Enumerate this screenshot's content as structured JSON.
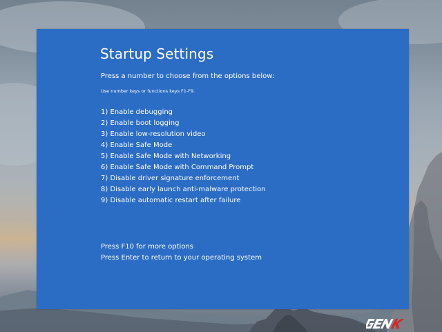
{
  "startup_settings": {
    "title": "Startup Settings",
    "prompt": "Press a number to choose from the options below:",
    "hint": "Use number keys or functions keys F1-F9.",
    "options": [
      {
        "label": "1) Enable debugging"
      },
      {
        "label": "2) Enable boot logging"
      },
      {
        "label": "3) Enable low-resolution video"
      },
      {
        "label": "4) Enable Safe Mode"
      },
      {
        "label": "5) Enable Safe Mode with Networking"
      },
      {
        "label": "6) Enable Safe Mode with Command Prompt"
      },
      {
        "label": "7) Disable driver signature enforcement"
      },
      {
        "label": "8) Disable early launch anti-malware protection"
      },
      {
        "label": "9) Disable automatic restart after failure"
      }
    ],
    "footer": {
      "more_options": "Press F10 for more options",
      "return_to_os": "Press Enter to return to your operating system"
    }
  },
  "watermark": {
    "text": "GENK"
  },
  "colors": {
    "screen_background": "#2b6cc4",
    "text": "#ffffff"
  }
}
